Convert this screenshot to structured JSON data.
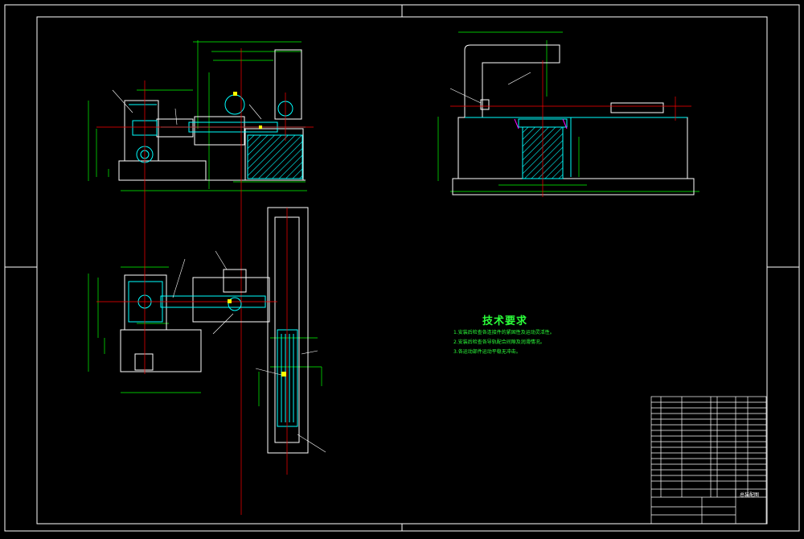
{
  "technical_requirements": {
    "title": "技术要求",
    "items": [
      "1.安装后检查各连接件的紧固性及运动灵活性。",
      "2.安装后检查各导轨配合间隙及润滑情况。",
      "3.各运动部件运动平稳无冲击。"
    ]
  },
  "title_block": {
    "drawing_name": "总装配图"
  },
  "colors": {
    "background": "#000000",
    "frame": "#ffffff",
    "outline": "#00ffff",
    "centerline": "#ff0000",
    "dimension": "#00ff00",
    "parts": "#ffffff",
    "hatch": "#00ffff",
    "magenta": "#ff00ff",
    "yellow": "#ffff00"
  }
}
